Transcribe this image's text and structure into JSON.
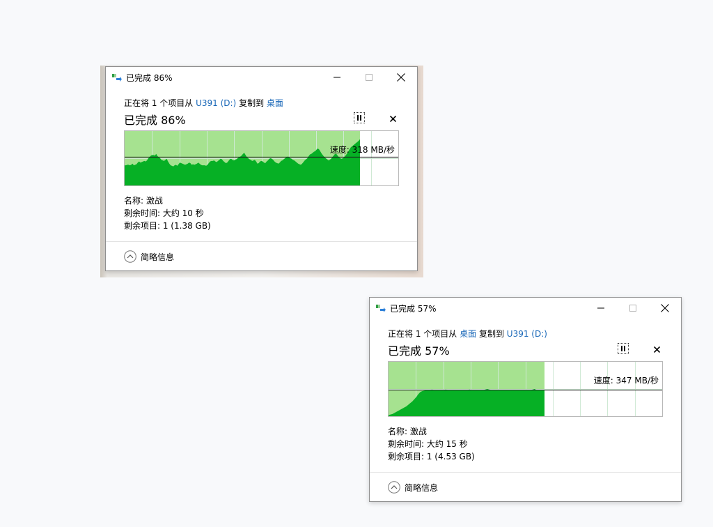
{
  "colors": {
    "link": "#1766b7",
    "graph_area": "#06b025",
    "graph_progress_bg": "#a6e290",
    "grid": "#cfe9d4"
  },
  "dialogs": [
    {
      "title": "已完成 86%",
      "percent_title": "已完成 86%",
      "progress": 0.86,
      "info": {
        "prefix": "正在将 1 个项目从",
        "source": "U391 (D:)",
        "middle": "复制到",
        "destination": "桌面"
      },
      "speed_label": "速度: 318 MB/秒",
      "details": {
        "name": "名称: 激战",
        "time_remaining": "剩余时间: 大约 10 秒",
        "items_remaining": "剩余项目: 1 (1.38 GB)"
      },
      "toggle_label": "简略信息",
      "speed_level": 0.52,
      "speed_samples": [
        0.37,
        0.37,
        0.38,
        0.38,
        0.37,
        0.38,
        0.4,
        0.37,
        0.38,
        0.39,
        0.42,
        0.44,
        0.42,
        0.43,
        0.44,
        0.45,
        0.44,
        0.46,
        0.5,
        0.52,
        0.55,
        0.56,
        0.56,
        0.55,
        0.58,
        0.54,
        0.52,
        0.5,
        0.47,
        0.46,
        0.45,
        0.47,
        0.49,
        0.44,
        0.4,
        0.37,
        0.36,
        0.35,
        0.37,
        0.38,
        0.36,
        0.39,
        0.42,
        0.41,
        0.4,
        0.39,
        0.38,
        0.39,
        0.4,
        0.42,
        0.41,
        0.38,
        0.39,
        0.38,
        0.39,
        0.4,
        0.42,
        0.4,
        0.38,
        0.37,
        0.37,
        0.37,
        0.36,
        0.38,
        0.41,
        0.44,
        0.45,
        0.45,
        0.46,
        0.44,
        0.43,
        0.45,
        0.47,
        0.49,
        0.48,
        0.45,
        0.43,
        0.41,
        0.42,
        0.45,
        0.48,
        0.49,
        0.47,
        0.46,
        0.47,
        0.48,
        0.5,
        0.52,
        0.53,
        0.55,
        0.58,
        0.6,
        0.56,
        0.52,
        0.5,
        0.48,
        0.47,
        0.45,
        0.46,
        0.47,
        0.44,
        0.4,
        0.41,
        0.44,
        0.45,
        0.44,
        0.42,
        0.41,
        0.44,
        0.46,
        0.49,
        0.5,
        0.49,
        0.47,
        0.44,
        0.42,
        0.41,
        0.4,
        0.42,
        0.45,
        0.46,
        0.48,
        0.5,
        0.52,
        0.53,
        0.52,
        0.5,
        0.49,
        0.47,
        0.46,
        0.44,
        0.42,
        0.4,
        0.39,
        0.38,
        0.4,
        0.43,
        0.46,
        0.48,
        0.5,
        0.54,
        0.57,
        0.58,
        0.6,
        0.62,
        0.63,
        0.66,
        0.68,
        0.66,
        0.62,
        0.58,
        0.55,
        0.52,
        0.5,
        0.48,
        0.46,
        0.47,
        0.49,
        0.52,
        0.55,
        0.58,
        0.58,
        0.55,
        0.52,
        0.5,
        0.49,
        0.5,
        0.52,
        0.55,
        0.58,
        0.62,
        0.66,
        0.7,
        0.72,
        0.74,
        0.76,
        0.78,
        0.8,
        0.82,
        0.85
      ]
    },
    {
      "title": "已完成 57%",
      "percent_title": "已完成 57%",
      "progress": 0.57,
      "info": {
        "prefix": "正在将 1 个项目从",
        "source": "桌面",
        "middle": "复制到",
        "destination": "U391 (D:)"
      },
      "speed_label": "速度: 347 MB/秒",
      "details": {
        "name": "名称: 激战",
        "time_remaining": "剩余时间: 大约 15 秒",
        "items_remaining": "剩余项目: 1 (4.53 GB)"
      },
      "toggle_label": "简略信息",
      "speed_level": 0.48,
      "speed_samples": [
        0.02,
        0.03,
        0.04,
        0.06,
        0.08,
        0.1,
        0.12,
        0.14,
        0.16,
        0.18,
        0.21,
        0.24,
        0.27,
        0.31,
        0.35,
        0.4,
        0.44,
        0.46,
        0.47,
        0.48,
        0.48,
        0.48,
        0.49,
        0.48,
        0.48,
        0.48,
        0.48,
        0.48,
        0.48,
        0.49,
        0.48,
        0.48,
        0.48,
        0.48,
        0.48,
        0.48,
        0.48,
        0.48,
        0.48,
        0.48,
        0.48,
        0.49,
        0.48,
        0.48,
        0.48,
        0.48,
        0.48,
        0.48,
        0.48,
        0.49,
        0.5,
        0.49,
        0.48,
        0.48,
        0.48,
        0.48,
        0.48,
        0.48,
        0.48,
        0.48,
        0.48,
        0.48,
        0.48,
        0.48,
        0.48,
        0.48,
        0.48,
        0.48,
        0.48,
        0.48,
        0.48,
        0.48,
        0.48,
        0.49,
        0.5,
        0.48,
        0.48,
        0.48,
        0.48,
        0.48
      ]
    }
  ]
}
